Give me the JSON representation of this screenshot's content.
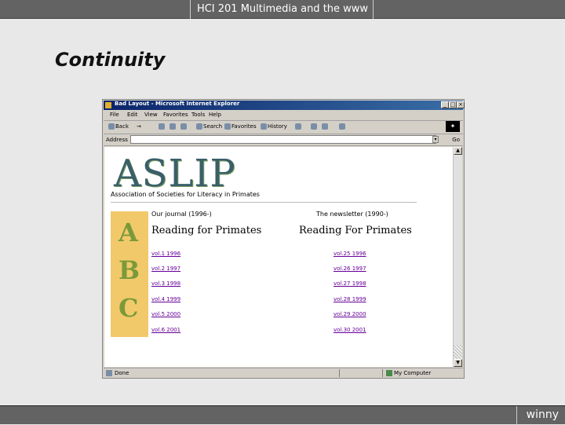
{
  "slide": {
    "header": "HCI 201 Multimedia and the www",
    "title": "Continuity",
    "footer": "winny"
  },
  "browser": {
    "window_title": "Bad Layout - Microsoft Internet Explorer",
    "menu": [
      "File",
      "Edit",
      "View",
      "Favorites",
      "Tools",
      "Help"
    ],
    "toolbar": [
      "Back",
      "→",
      "Search",
      "Favorites",
      "History"
    ],
    "address_label": "Address",
    "go_label": "Go",
    "status_left": "Done",
    "status_right": "My Computer",
    "window_buttons": [
      "_",
      "□",
      "×"
    ]
  },
  "page": {
    "logo_text": "ASLIP",
    "logo_subtitle": "Association of Societies for Literacy in Primates",
    "abc_letters": [
      "A",
      "B",
      "C"
    ],
    "left_column": {
      "caption": "Our journal (1996-)",
      "heading": "Reading for Primates",
      "links": [
        "vol.1 1996",
        "vol.2 1997",
        "vol.3 1998",
        "vol.4 1999",
        "vol.5 2000",
        "vol.6 2001"
      ]
    },
    "right_column": {
      "caption": "The newsletter (1990-)",
      "heading": "Reading For Primates",
      "links": [
        "vol.25 1996",
        "vol.26 1997",
        "vol.27 1998",
        "vol.28 1999",
        "vol.29 2000",
        "vol.30 2001"
      ]
    }
  }
}
